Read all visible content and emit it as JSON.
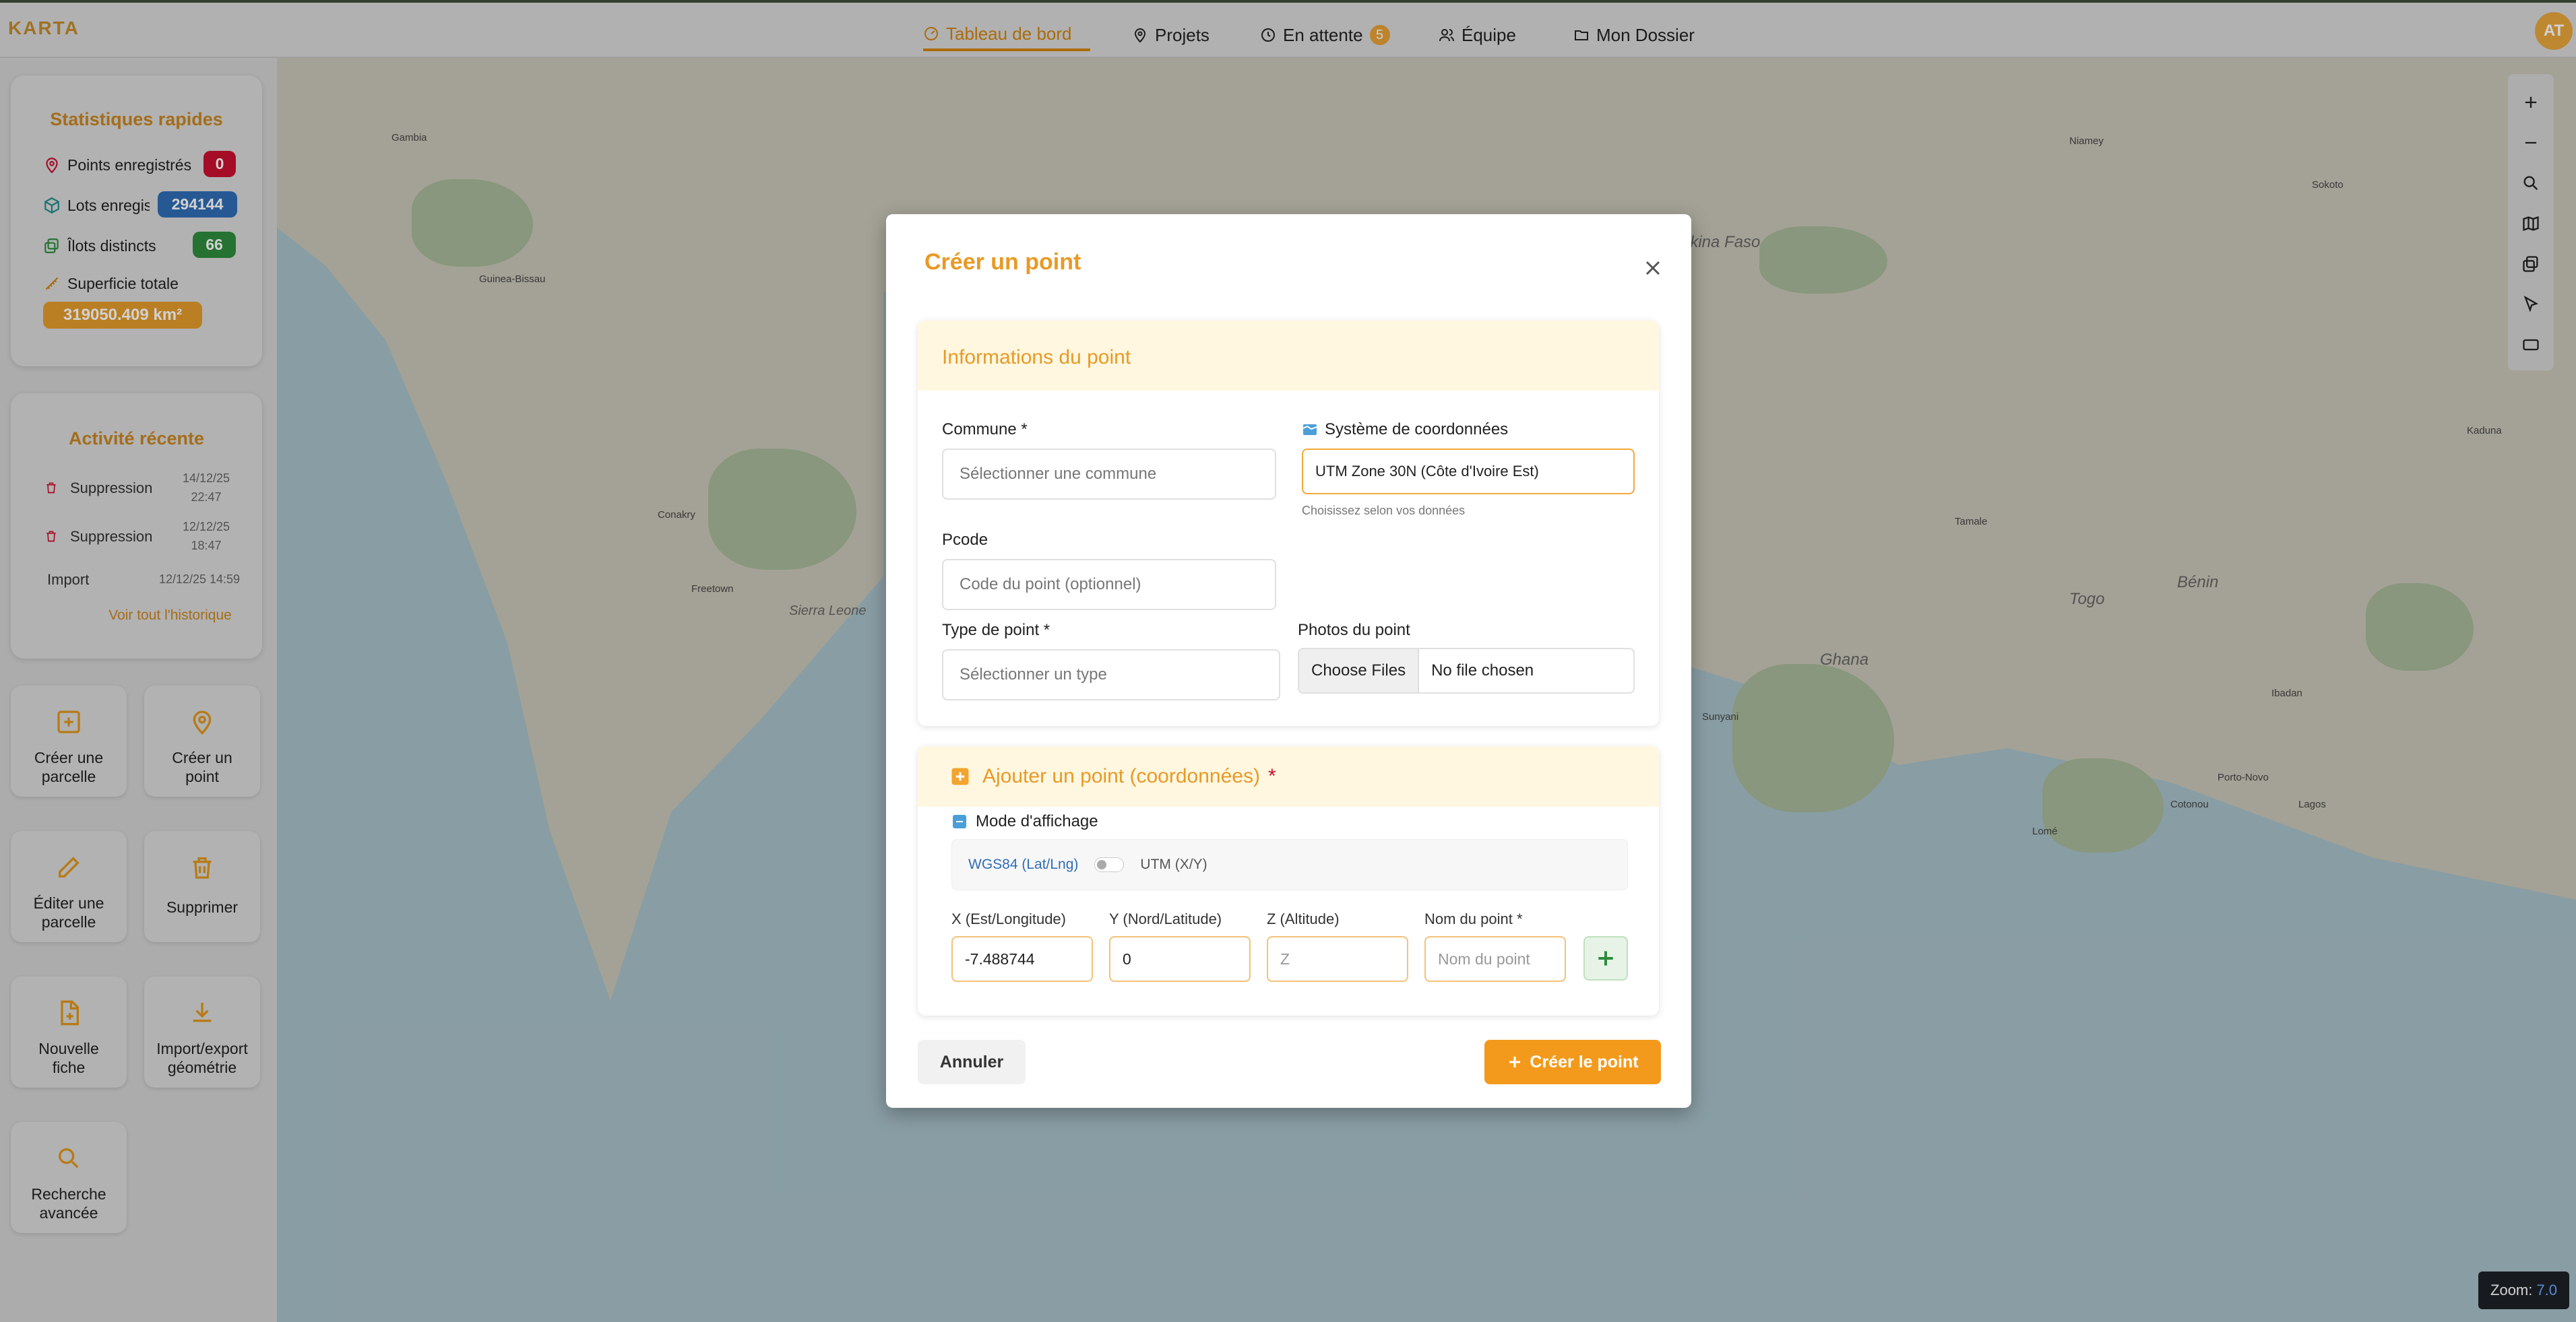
{
  "app": {
    "logo": "KARTA",
    "avatar_initials": "AT"
  },
  "nav": {
    "dashboard": "Tableau de bord",
    "projects": "Projets",
    "pending": "En attente",
    "pending_count": "5",
    "team": "Équipe",
    "folder": "Mon Dossier"
  },
  "stats": {
    "title": "Statistiques rapides",
    "points_label": "Points enregistrés",
    "points_value": "0",
    "lots_label": "Lots enregistrés",
    "lots_value": "294144",
    "ilots_label": "Îlots distincts",
    "ilots_value": "66",
    "area_label": "Superficie totale",
    "area_value": "319050.409 km²"
  },
  "activity": {
    "title": "Activité récente",
    "items": [
      {
        "label": "Suppression",
        "date": "14/12/25",
        "time": "22:47"
      },
      {
        "label": "Suppression",
        "date": "12/12/25",
        "time": "18:47"
      },
      {
        "label": "Import",
        "date": "12/12/25 14:59"
      }
    ],
    "history_link": "Voir tout l'historique"
  },
  "actions": {
    "create_parcel": [
      "Créer une",
      "parcelle"
    ],
    "create_point": [
      "Créer un",
      "point"
    ],
    "edit_parcel": [
      "Éditer une",
      "parcelle"
    ],
    "delete": "Supprimer",
    "new_sheet": [
      "Nouvelle",
      "fiche"
    ],
    "import_export": [
      "Import/export",
      "géométrie"
    ],
    "advanced_search": [
      "Recherche",
      "avancée"
    ]
  },
  "modal": {
    "title": "Créer un point",
    "info_section": "Informations du point",
    "commune_label": "Commune *",
    "commune_placeholder": "Sélectionner une commune",
    "crs_label": "Système de coordonnées",
    "crs_value": "UTM Zone 30N (Côte d'Ivoire Est)",
    "crs_hint": "Choisissez selon vos données",
    "pcode_label": "Pcode",
    "pcode_placeholder": "Code du point (optionnel)",
    "type_label": "Type de point *",
    "type_placeholder": "Sélectionner un type",
    "photos_label": "Photos du point",
    "choose_files": "Choose Files",
    "no_file": "No file chosen",
    "coord_section": "Ajouter un point (coordonnées)",
    "coord_required": "*",
    "display_mode_label": "Mode d'affichage",
    "mode_wgs": "WGS84 (Lat/Lng)",
    "mode_utm": "UTM (X/Y)",
    "x_label": "X (Est/Longitude)",
    "x_value": "-7.488744",
    "y_label": "Y (Nord/Latitude)",
    "y_value": "0",
    "z_label": "Z (Altitude)",
    "z_placeholder": "Z",
    "name_label": "Nom du point *",
    "name_placeholder": "Nom du point",
    "cancel": "Annuler",
    "submit": "Créer le point"
  },
  "map": {
    "zoom_label": "Zoom:",
    "zoom_value": "7.0",
    "labels": [
      "Gambia",
      "Guinea-Bissau",
      "Conakry",
      "Freetown",
      "Sierra Leone",
      "Burkina Faso",
      "Ghana",
      "Togo",
      "Bénin",
      "Cotonou",
      "Lomé",
      "Porto-Novo",
      "Lagos",
      "Niamey",
      "Tamale",
      "Ibadan",
      "Sokoto",
      "Kaduna",
      "Sunyani"
    ]
  },
  "colors": {
    "accent": "#e89a26",
    "blue_pill": "#2f6db5",
    "green_pill": "#2e8b3e",
    "red_pill": "#c8102e"
  }
}
